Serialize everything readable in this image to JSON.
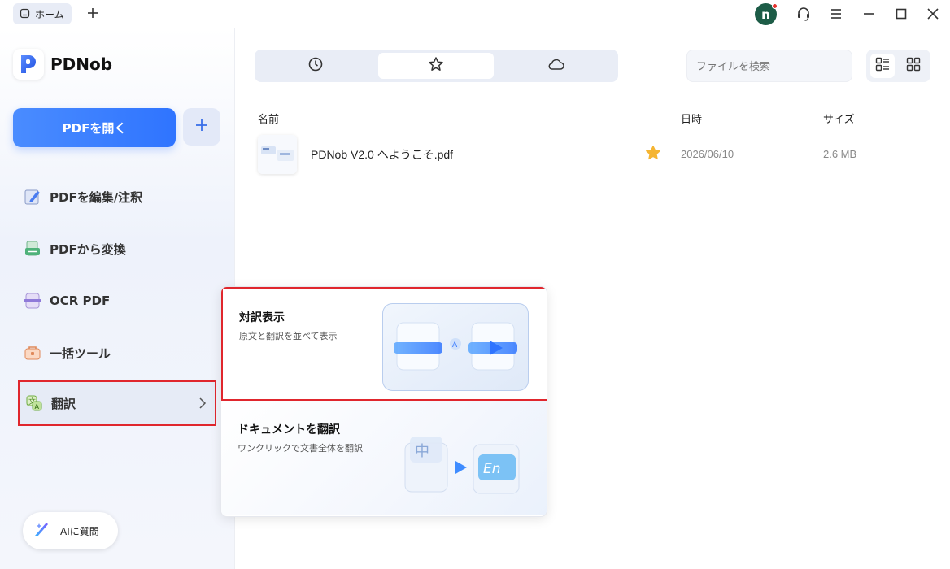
{
  "titlebar": {
    "home_tab": "ホーム",
    "avatar_letter": "n"
  },
  "sidebar": {
    "app_name": "PDNob",
    "open_button": "PDFを開く",
    "items": [
      {
        "label": "PDFを編集/注釈",
        "icon": "edit-icon"
      },
      {
        "label": "PDFから変換",
        "icon": "convert-icon"
      },
      {
        "label": "OCR PDF",
        "icon": "ocr-icon"
      },
      {
        "label": "一括ツール",
        "icon": "toolbox-icon"
      },
      {
        "label": "翻訳",
        "icon": "translate-icon"
      }
    ],
    "ai_button": "AIに質問"
  },
  "main": {
    "tabs": [
      "recent-clock-icon",
      "favorites-star-icon",
      "cloud-icon"
    ],
    "active_tab": 1,
    "search_placeholder": "ファイルを検索",
    "columns": {
      "name": "名前",
      "date": "日時",
      "size": "サイズ"
    },
    "files": [
      {
        "name": "PDNob V2.0 へようこそ.pdf",
        "date": "2026/06/10",
        "size": "2.6 MB",
        "starred": true
      }
    ]
  },
  "translate_menu": {
    "options": [
      {
        "title": "対訳表示",
        "desc": "原文と翻訳を並べて表示"
      },
      {
        "title": "ドキュメントを翻訳",
        "desc": "ワンクリックで文書全体を翻訳"
      }
    ]
  },
  "colors": {
    "accent": "#2f74ff",
    "highlight_border": "#e0262d",
    "star": "#f5b533",
    "avatar": "#1d5c47"
  }
}
